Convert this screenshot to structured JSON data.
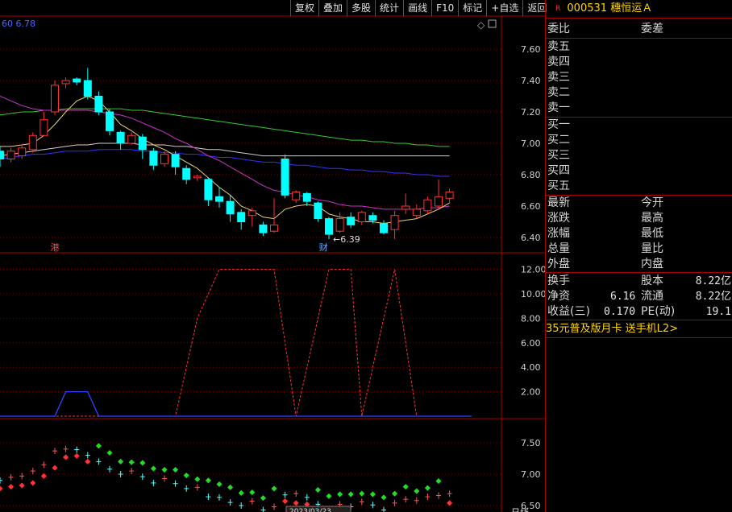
{
  "toolbar": [
    "复权",
    "叠加",
    "多股",
    "统计",
    "画线",
    "F10",
    "标记",
    "+自选",
    "返回"
  ],
  "main_chart": {
    "ma_readout": "60  6.78",
    "y_ticks": [
      "7.60",
      "7.40",
      "7.20",
      "7.00",
      "6.80",
      "6.60",
      "6.40"
    ],
    "low_marker": "6.39",
    "markers": [
      "港",
      "财"
    ],
    "candles": [
      [
        6.95,
        6.9,
        6.98,
        6.85
      ],
      [
        6.9,
        6.95,
        6.97,
        6.88
      ],
      [
        6.92,
        6.97,
        6.99,
        6.9
      ],
      [
        6.96,
        7.05,
        7.07,
        6.94
      ],
      [
        7.05,
        7.15,
        7.2,
        7.05
      ],
      [
        7.2,
        7.37,
        7.4,
        7.18
      ],
      [
        7.38,
        7.4,
        7.42,
        7.35
      ],
      [
        7.41,
        7.39,
        7.42,
        7.37
      ],
      [
        7.4,
        7.3,
        7.48,
        7.28
      ],
      [
        7.3,
        7.2,
        7.33,
        7.18
      ],
      [
        7.2,
        7.08,
        7.22,
        7.05
      ],
      [
        7.07,
        7.0,
        7.08,
        6.96
      ],
      [
        7.0,
        7.05,
        7.07,
        6.99
      ],
      [
        7.04,
        6.96,
        7.06,
        6.9
      ],
      [
        6.95,
        6.86,
        6.97,
        6.83
      ],
      [
        6.87,
        6.93,
        6.95,
        6.85
      ],
      [
        6.93,
        6.85,
        6.95,
        6.8
      ],
      [
        6.84,
        6.77,
        6.86,
        6.74
      ],
      [
        6.78,
        6.79,
        6.8,
        6.76
      ],
      [
        6.77,
        6.64,
        6.78,
        6.6
      ],
      [
        6.66,
        6.63,
        6.72,
        6.59
      ],
      [
        6.63,
        6.55,
        6.67,
        6.5
      ],
      [
        6.56,
        6.5,
        6.58,
        6.45
      ],
      [
        6.54,
        6.57,
        6.59,
        6.47
      ],
      [
        6.48,
        6.43,
        6.5,
        6.41
      ],
      [
        6.44,
        6.48,
        6.65,
        6.43
      ],
      [
        6.9,
        6.67,
        6.93,
        6.65
      ],
      [
        6.64,
        6.69,
        6.7,
        6.62
      ],
      [
        6.68,
        6.63,
        6.69,
        6.6
      ],
      [
        6.62,
        6.52,
        6.63,
        6.5
      ],
      [
        6.52,
        6.42,
        6.53,
        6.39
      ],
      [
        6.44,
        6.52,
        6.56,
        6.43
      ],
      [
        6.53,
        6.48,
        6.56,
        6.46
      ],
      [
        6.5,
        6.56,
        6.57,
        6.48
      ],
      [
        6.54,
        6.51,
        6.56,
        6.49
      ],
      [
        6.49,
        6.43,
        6.51,
        6.42
      ],
      [
        6.45,
        6.54,
        6.57,
        6.39
      ],
      [
        6.58,
        6.6,
        6.68,
        6.55
      ],
      [
        6.54,
        6.58,
        6.61,
        6.52
      ],
      [
        6.57,
        6.64,
        6.66,
        6.55
      ],
      [
        6.6,
        6.66,
        6.77,
        6.58
      ],
      [
        6.65,
        6.69,
        6.71,
        6.62
      ]
    ],
    "ma_white": [
      6.92,
      6.93,
      6.94,
      6.95,
      6.96,
      6.97,
      6.98,
      6.99,
      6.99,
      7.0,
      7.0,
      7.0,
      7.0,
      6.99,
      6.99,
      6.99,
      6.98,
      6.98,
      6.97,
      6.96,
      6.96,
      6.95,
      6.94,
      6.93,
      6.92,
      6.92,
      6.92,
      6.92,
      6.92,
      6.92,
      6.92,
      6.92,
      6.92,
      6.92,
      6.92,
      6.92,
      6.92,
      6.92,
      6.92,
      6.92,
      6.92,
      6.92
    ],
    "ma_magenta": [
      7.3,
      7.27,
      7.24,
      7.22,
      7.21,
      7.21,
      7.21,
      7.21,
      7.21,
      7.2,
      7.19,
      7.18,
      7.16,
      7.13,
      7.1,
      7.07,
      7.03,
      7.0,
      6.96,
      6.92,
      6.89,
      6.85,
      6.81,
      6.77,
      6.73,
      6.7,
      6.69,
      6.67,
      6.66,
      6.64,
      6.63,
      6.61,
      6.6,
      6.6,
      6.59,
      6.58,
      6.58,
      6.58,
      6.58,
      6.59,
      6.59,
      6.6
    ],
    "ma_green": [
      7.18,
      7.19,
      7.2,
      7.2,
      7.21,
      7.21,
      7.22,
      7.22,
      7.22,
      7.22,
      7.22,
      7.22,
      7.21,
      7.21,
      7.2,
      7.19,
      7.18,
      7.17,
      7.16,
      7.15,
      7.14,
      7.13,
      7.12,
      7.11,
      7.1,
      7.09,
      7.08,
      7.07,
      7.06,
      7.05,
      7.04,
      7.03,
      7.02,
      7.02,
      7.01,
      7.01,
      7.0,
      7.0,
      6.99,
      6.99,
      6.98,
      6.98
    ],
    "ma_blue": [
      6.9,
      6.91,
      6.92,
      6.93,
      6.93,
      6.94,
      6.95,
      6.95,
      6.95,
      6.96,
      6.96,
      6.96,
      6.96,
      6.95,
      6.95,
      6.94,
      6.94,
      6.93,
      6.93,
      6.92,
      6.91,
      6.91,
      6.9,
      6.89,
      6.88,
      6.88,
      6.87,
      6.86,
      6.86,
      6.85,
      6.84,
      6.84,
      6.83,
      6.83,
      6.82,
      6.82,
      6.81,
      6.81,
      6.8,
      6.8,
      6.79,
      6.79
    ],
    "ma_yellow": [
      6.98,
      6.98,
      6.99,
      7.0,
      7.05,
      7.12,
      7.2,
      7.27,
      7.3,
      7.27,
      7.2,
      7.12,
      7.08,
      7.03,
      6.99,
      6.96,
      6.92,
      6.88,
      6.84,
      6.78,
      6.72,
      6.67,
      6.6,
      6.57,
      6.53,
      6.52,
      6.58,
      6.6,
      6.61,
      6.6,
      6.55,
      6.53,
      6.52,
      6.5,
      6.5,
      6.49,
      6.5,
      6.51,
      6.52,
      6.55,
      6.58,
      6.62
    ]
  },
  "indicator_chart": {
    "y_ticks": [
      "12.00",
      "10.00",
      "8.00",
      "6.00",
      "4.00",
      "2.00"
    ],
    "red_x": [
      0,
      6,
      9,
      13,
      14,
      16,
      18,
      20,
      22,
      25,
      27,
      30,
      32,
      33,
      36,
      38,
      40,
      41,
      43
    ],
    "red_y": [
      0,
      0,
      0,
      0,
      0,
      0,
      8,
      12,
      12,
      12,
      0,
      12,
      12,
      0,
      12,
      0,
      0,
      0,
      0
    ],
    "blue_x": [
      0,
      5,
      6,
      8,
      9,
      15,
      16,
      30,
      43
    ],
    "blue_y": [
      0,
      0,
      2,
      2,
      0,
      0,
      0,
      0,
      0
    ]
  },
  "lower_chart": {
    "y_ticks": [
      "7.50",
      "7.00",
      "6.50"
    ],
    "date_label": "2023/03/23",
    "right_label": "日线"
  },
  "sidebar": {
    "stock_code": "000531",
    "stock_name": "穗恒运Ａ",
    "r_badge": "R",
    "weibi": "委比",
    "weicha": "委差",
    "sells": [
      "卖五",
      "卖四",
      "卖三",
      "卖二",
      "卖一"
    ],
    "buys": [
      "买一",
      "买二",
      "买三",
      "买四",
      "买五"
    ],
    "quote_left": [
      "最新",
      "涨跌",
      "涨幅",
      "总量",
      "外盘"
    ],
    "quote_right": [
      "今开",
      "最高",
      "最低",
      "量比",
      "内盘"
    ],
    "huanshou": "换手",
    "guben": "股本",
    "guben_val": "8.22亿",
    "jingzi": "净资",
    "jingzi_val": "6.16",
    "liutong": "流通",
    "liutong_val": "8.22亿",
    "shouyi": "收益(三)",
    "shouyi_val": "0.170",
    "pe": "PE(动)",
    "pe_val": "19.1",
    "promo": "35元普及版月卡 送手机L2>"
  },
  "colors": {
    "up": "#ff3333",
    "down": "#00ffff",
    "border": "#aa0000"
  }
}
